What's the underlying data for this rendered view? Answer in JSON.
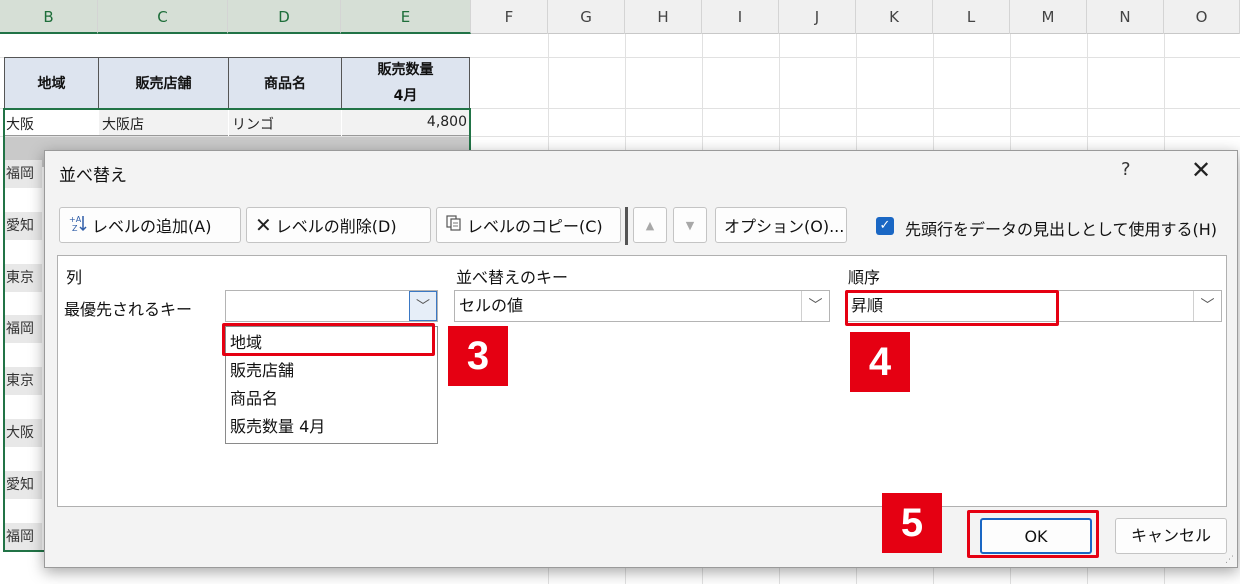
{
  "sheet": {
    "columns": [
      "B",
      "C",
      "D",
      "E",
      "F",
      "G",
      "H",
      "I",
      "J",
      "K",
      "L",
      "M",
      "N",
      "O"
    ],
    "header": {
      "region": "地域",
      "store": "販売店舗",
      "product": "商品名",
      "quantity_line1": "販売数量",
      "quantity_line2": "4月"
    },
    "first_row": {
      "region": "大阪",
      "store": "大阪店",
      "product": "リンゴ",
      "quantity": "4,800"
    },
    "left_column": [
      "福岡",
      "愛知",
      "東京",
      "福岡",
      "東京",
      "大阪",
      "愛知",
      "福岡"
    ]
  },
  "dialog": {
    "title": "並べ替え",
    "help": "?",
    "close": "✕",
    "toolbar": {
      "add_level": "レベルの追加(A)",
      "delete_level": "レベルの削除(D)",
      "copy_level": "レベルのコピー(C)",
      "move_up": "▲",
      "move_down": "▼",
      "options": "オプション(O)...",
      "header_checkbox_label": "先頭行をデータの見出しとして使用する(H)",
      "header_checkbox_checked": true
    },
    "grid": {
      "col_label": "列",
      "key_label": "並べ替えのキー",
      "order_label": "順序",
      "row_label": "最優先されるキー",
      "column_value": "",
      "key_value": "セルの値",
      "order_value": "昇順"
    },
    "dropdown_options": [
      "地域",
      "販売店舗",
      "商品名",
      "販売数量 4月"
    ],
    "ok": "OK",
    "cancel": "キャンセル"
  },
  "annotations": {
    "step3": "3",
    "step4": "4",
    "step5": "5",
    "highlight_color": "#e50012"
  },
  "accent_color": "#217346"
}
